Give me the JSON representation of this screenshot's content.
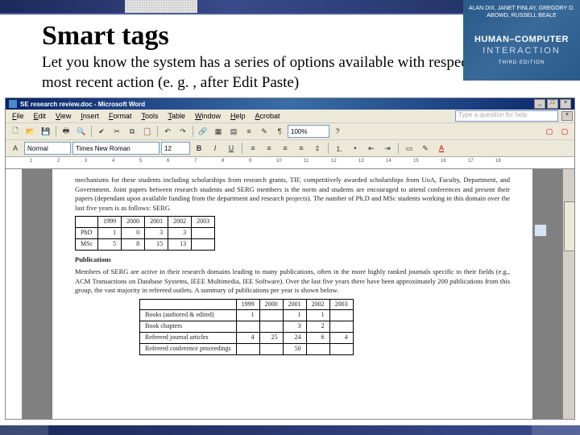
{
  "slide": {
    "title": "Smart tags",
    "body": "Let you know the system has a series of options available with respect to the most recent action (e. g. , after Edit Paste)"
  },
  "book": {
    "authors": "ALAN DIX, JANET FINLAY, GREGORY D. ABOWD, RUSSELL BEALE",
    "title_line1": "HUMAN–COMPUTER",
    "title_line2": "INTERACTION",
    "edition": "THIRD EDITION"
  },
  "word": {
    "titlebar": "SE research review.doc - Microsoft Word",
    "menus": [
      "File",
      "Edit",
      "View",
      "Insert",
      "Format",
      "Tools",
      "Table",
      "Window",
      "Help",
      "Acrobat"
    ],
    "help_placeholder": "Type a question for help",
    "zoom": "100%",
    "style": "Normal",
    "font": "Times New Roman",
    "font_size": "12",
    "ruler_marks": [
      "1",
      "2",
      "3",
      "4",
      "5",
      "6",
      "7",
      "8",
      "9",
      "10",
      "11",
      "12",
      "13",
      "14",
      "15",
      "16",
      "17",
      "18"
    ]
  },
  "doc": {
    "para1": "mechanisms for these students including scholarships from research grants, TIF, competitively awarded scholarships from UoA, Faculty, Department, and Government. Joint papers between research students and SERG members is the norm and students are encouraged to attend conferences and present their papers (dependant upon available funding from the department and research projects). The number of Ph.D and MSc students working in this domain over the last five years is as follows: SERG",
    "table1": {
      "headers": [
        "",
        "1999",
        "2000",
        "2001",
        "2002",
        "2003"
      ],
      "rows": [
        [
          "PhD",
          "1",
          "0",
          "3",
          "3",
          ""
        ],
        [
          "MSc",
          "5",
          "8",
          "15",
          "13",
          ""
        ]
      ]
    },
    "pub_head": "Publications",
    "para2": "Members of SERG are active in their research domains leading to many publications, often in the more highly ranked journals specific to their fields (e.g., ACM Transactions on Database Systems, IEEE Multimedia, IEE Software). Over the last five years there have been approximately 200 publications from this group, the vast majority in refereed outlets. A summary of publications per year is shown below.",
    "table2": {
      "headers": [
        "",
        "1999",
        "2000",
        "2001",
        "2002",
        "2003"
      ],
      "rows": [
        [
          "Books (authored & edited)",
          "1",
          "",
          "1",
          "1",
          ""
        ],
        [
          "Book chapters",
          "",
          "",
          "3",
          "2",
          ""
        ],
        [
          "Refereed journal articles",
          "4",
          "25",
          "24",
          "6",
          "4"
        ],
        [
          "Refereed conference proceedings",
          "",
          "",
          "50",
          "",
          ""
        ]
      ]
    }
  }
}
